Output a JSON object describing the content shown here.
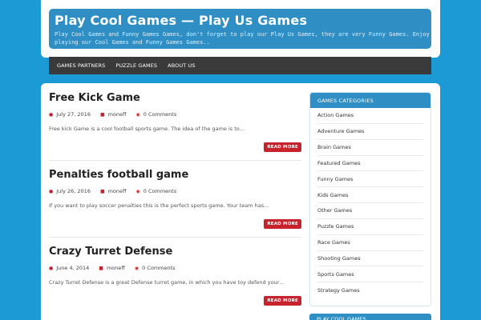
{
  "site": {
    "title": "Play Cool Games — Play Us Games",
    "description": "Play Cool Games and Funny Games Games, don't forget to play our Play Us Games, they are very Funny Games. Enjoy playing our Cool Games and Funny Games Games.."
  },
  "nav": {
    "items": [
      {
        "label": "GAMES PARTNERS"
      },
      {
        "label": "PUZZLE GAMES"
      },
      {
        "label": "ABOUT US"
      }
    ]
  },
  "posts": [
    {
      "title": "Free Kick Game",
      "date": "July 27, 2016",
      "author": "moneff",
      "comments": "0 Comments",
      "excerpt": "Free kick Game is a cool football sports game. The idea of the game is to…",
      "read_more": "READ MORE"
    },
    {
      "title": "Penalties football game",
      "date": "July 26, 2016",
      "author": "moneff",
      "comments": "0 Comments",
      "excerpt": "If you want to play soccer penalties this is the perfect sports game. Your team has…",
      "read_more": "READ MORE"
    },
    {
      "title": "Crazy Turret Defense",
      "date": "June 4, 2014",
      "author": "moneff",
      "comments": "0 Comments",
      "excerpt": "Crazy Turret Defense is a great Defense turret game, in which you have toy defend your…",
      "read_more": "READ MORE"
    }
  ],
  "sidebar": {
    "heading": "GAMES CATEGORIES",
    "categories": [
      "Action Games",
      "Adventure Games",
      "Brain Games",
      "Featured Games",
      "Funny Games",
      "Kids Games",
      "Other Games",
      "Puzzle Games",
      "Race Games",
      "Shooting Games",
      "Sports Games",
      "Strategy Games"
    ],
    "second_heading": "PLAY COOL GAMES"
  },
  "colors": {
    "background": "#1c9ad6",
    "banner": "#2f8fc4",
    "nav": "#3a3a3a",
    "accent_red": "#c8232c"
  },
  "icons": {
    "date": "calendar-icon",
    "author": "user-icon",
    "comments": "comment-icon"
  }
}
